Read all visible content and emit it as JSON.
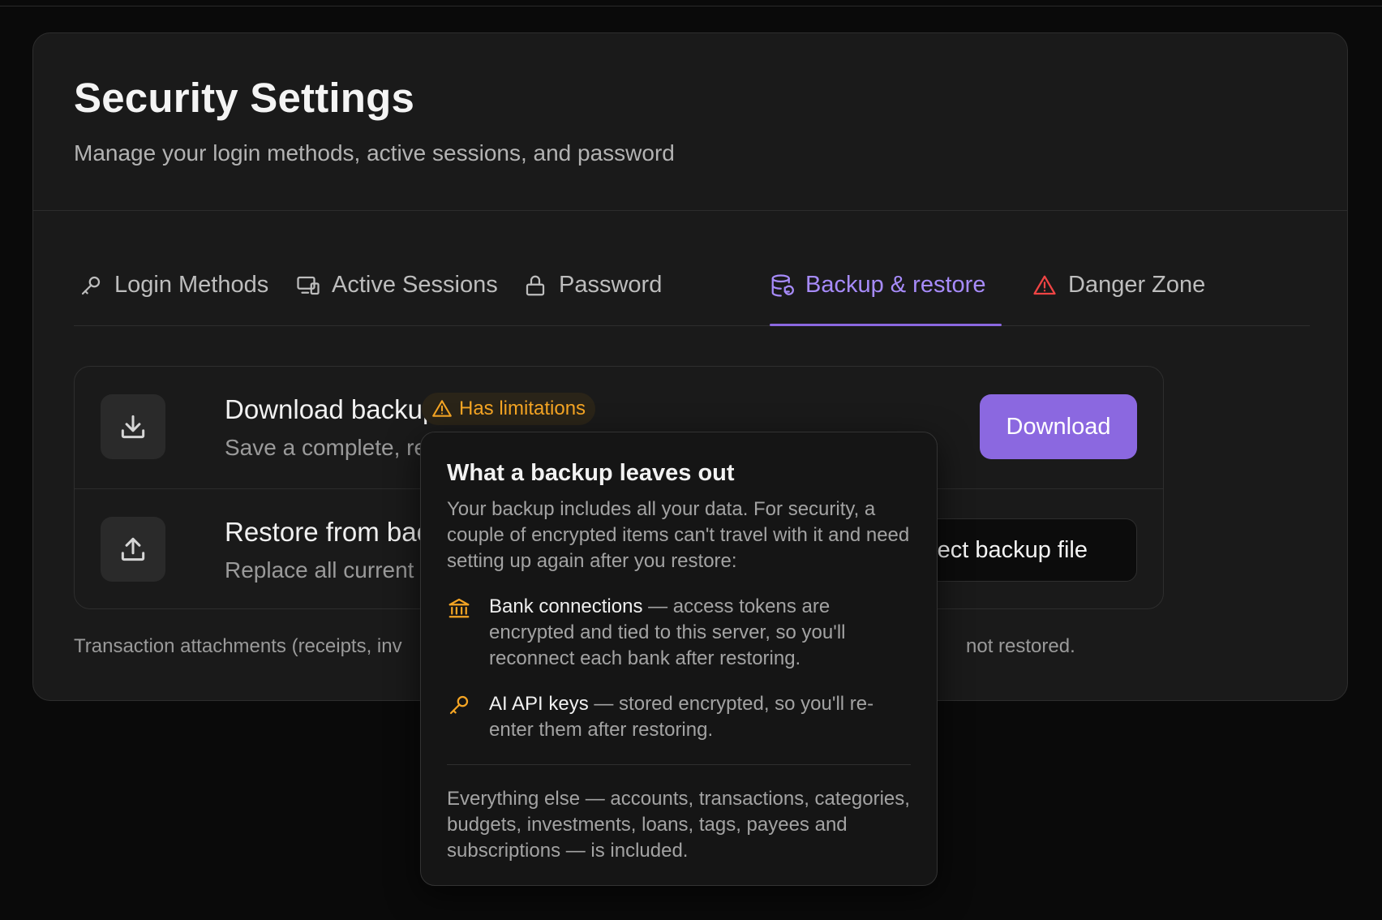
{
  "header": {
    "title": "Security Settings",
    "subtitle": "Manage your login methods, active sessions, and password"
  },
  "tabs": [
    {
      "label": "Login Methods",
      "icon": "key-icon",
      "active": false
    },
    {
      "label": "Active Sessions",
      "icon": "devices-icon",
      "active": false
    },
    {
      "label": "Password",
      "icon": "lock-icon",
      "active": false
    },
    {
      "label": "Backup & restore",
      "icon": "database-backup-icon",
      "active": true
    },
    {
      "label": "Danger Zone",
      "icon": "warning-triangle-icon",
      "active": false
    }
  ],
  "backup": {
    "download": {
      "title": "Download backup",
      "badge": "Has limitations",
      "description": "Save a complete, resto",
      "button": "Download"
    },
    "restore": {
      "title": "Restore from backu",
      "description": "Replace all current dat",
      "button": "elect backup file"
    },
    "footnote_start": "Transaction attachments (receipts, inv",
    "footnote_end": "not restored."
  },
  "popover": {
    "title": "What a backup leaves out",
    "intro": "Your backup includes all your data. For security, a couple of encrypted items can't travel with it and need setting up again after you restore:",
    "items": [
      {
        "label": "Bank connections",
        "text": " — access tokens are encrypted and tied to this server, so you'll reconnect each bank after restoring.",
        "icon": "bank-icon"
      },
      {
        "label": "AI API keys",
        "text": " — stored encrypted, so you'll re-enter them after restoring.",
        "icon": "key-icon"
      }
    ],
    "footer": "Everything else — accounts, transactions, categories, budgets, investments, loans, tags, payees and subscriptions — is included."
  },
  "colors": {
    "accent": "#8b68e0",
    "accent_text": "#a78bfa",
    "warning": "#f5a524",
    "danger": "#ef4444",
    "background": "#0a0a0a",
    "card": "#1a1a1a"
  }
}
